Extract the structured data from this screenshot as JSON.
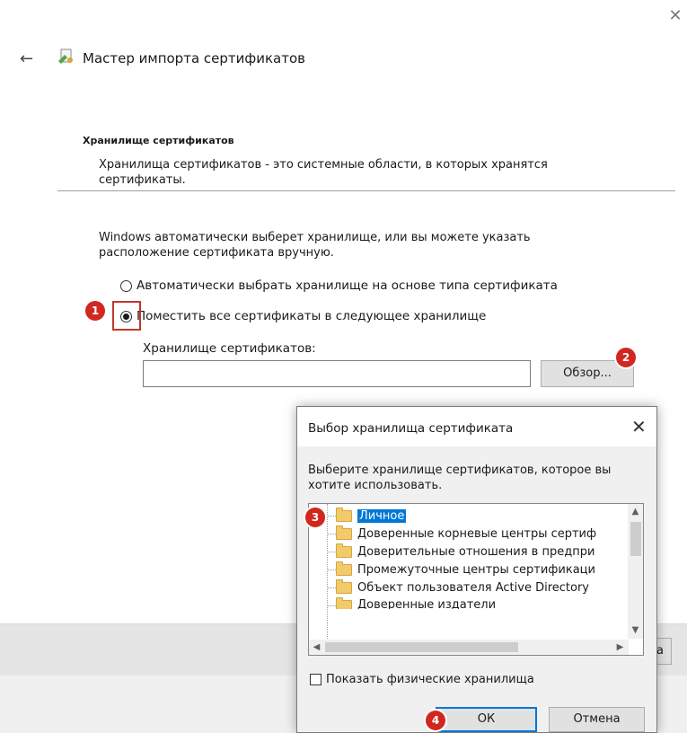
{
  "window": {
    "close_icon": "close-icon"
  },
  "wizard": {
    "title": "Мастер импорта сертификатов",
    "section_heading": "Хранилище сертификатов",
    "section_desc": "Хранилища сертификатов - это системные области, в которых хранятся сертификаты.",
    "info_text": "Windows автоматически выберет хранилище, или вы можете указать расположение сертификата вручную.",
    "radio_auto_label": "Автоматически выбрать хранилище на основе типа сертификата",
    "radio_manual_label": "Поместить все сертификаты в следующее хранилище",
    "selected_option": "manual",
    "store_label": "Хранилище сертификатов:",
    "store_value": "",
    "browse_label": "Обзор...",
    "partial_button_label": "а"
  },
  "badges": {
    "b1": "1",
    "b2": "2",
    "b3": "3",
    "b4": "4"
  },
  "dialog": {
    "title": "Выбор хранилища сертификата",
    "desc": "Выберите хранилище сертификатов, которое вы хотите использовать.",
    "tree_items": [
      "Личное",
      "Доверенные корневые центры сертиф",
      "Доверительные отношения в предпри",
      "Промежуточные центры сертификаци",
      "Объект пользователя Active Directory",
      "Доверенные издатели"
    ],
    "selected_item": "Личное",
    "show_physical_label": "Показать физические хранилища",
    "show_physical_checked": false,
    "ok_label": "ОК",
    "cancel_label": "Отмена"
  },
  "colors": {
    "accent": "#0078d7",
    "badge": "#d0281f",
    "folder": "#f1cb6b"
  }
}
